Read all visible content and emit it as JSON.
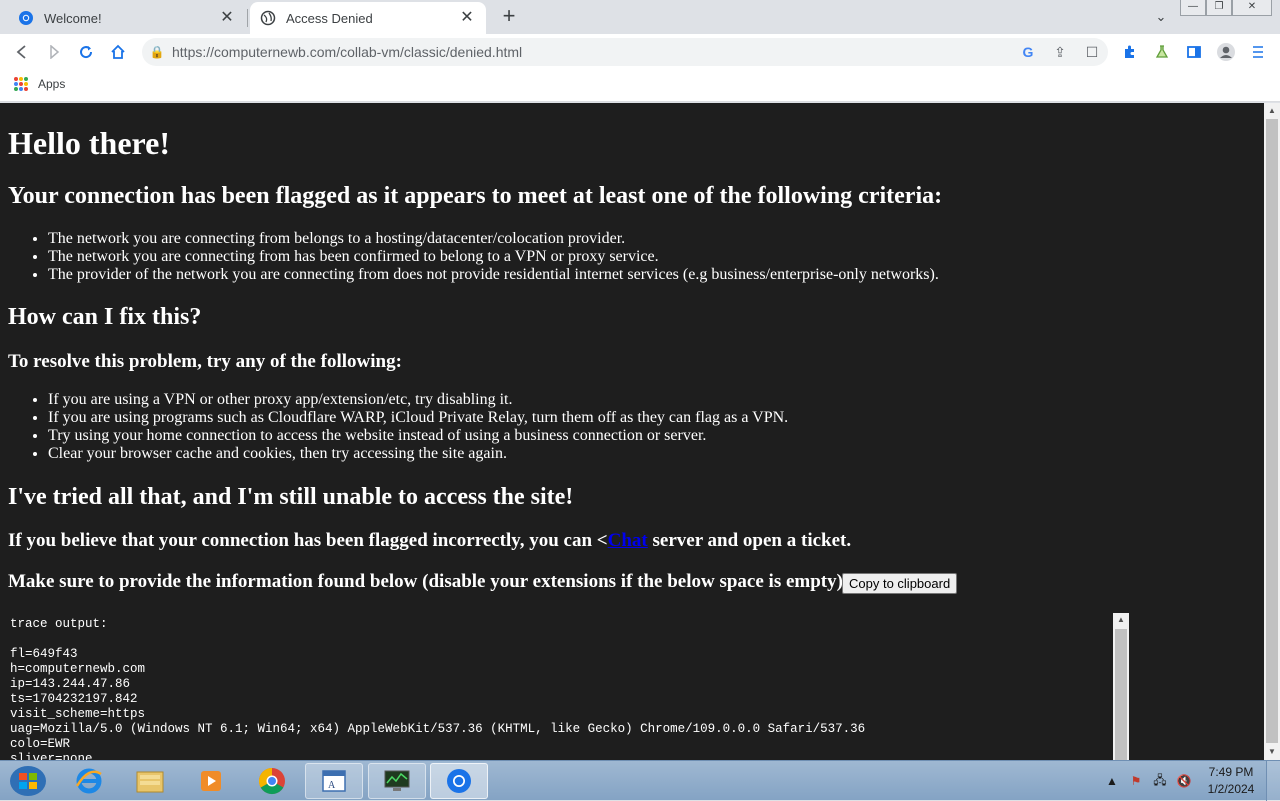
{
  "tabs": [
    {
      "title": "Welcome!",
      "active": false
    },
    {
      "title": "Access Denied",
      "active": true
    }
  ],
  "omnibox": {
    "url_host": "https://computernewb.com",
    "url_path": "/collab-vm/classic/denied.html"
  },
  "bookmarks": {
    "apps_label": "Apps"
  },
  "content": {
    "h1": "Hello there!",
    "h2_flagged": "Your connection has been flagged as it appears to meet at least one of the following criteria:",
    "criteria": [
      "The network you are connecting from belongs to a hosting/datacenter/colocation provider.",
      "The network you are connecting from has been confirmed to belong to a VPN or proxy service.",
      "The provider of the network you are connecting from does not provide residential internet services (e.g business/enterprise-only networks)."
    ],
    "h2_fix": "How can I fix this?",
    "h3_resolve": "To resolve this problem, try any of the following:",
    "fixes": [
      "If you are using a VPN or other proxy app/extension/etc, try disabling it.",
      "If you are using programs such as Cloudflare WARP, iCloud Private Relay, turn them off as they can flag as a VPN.",
      "Try using your home connection to access the website instead of using a business connection or server.",
      "Clear your browser cache and cookies, then try accessing the site again."
    ],
    "h2_tried": "I've tried all that, and I'm still unable to access the site!",
    "incorrect_prefix": "If you believe that your connection has been flagged incorrectly, you can <",
    "chat_link": "Chat",
    "incorrect_suffix": " server and open a ticket.",
    "provide_info": "Make sure to provide the information found below (disable your extensions if the below space is empty):",
    "copy_button": "Copy to clipboard",
    "trace": "trace output:\n\nfl=649f43\nh=computernewb.com\nip=143.244.47.86\nts=1704232197.842\nvisit_scheme=https\nuag=Mozilla/5.0 (Windows NT 6.1; Win64; x64) AppleWebKit/537.36 (KHTML, like Gecko) Chrome/109.0.0.0 Safari/537.36\ncolo=EWR\nsliver=none"
  },
  "taskbar": {
    "time": "7:49 PM",
    "date": "1/2/2024"
  }
}
